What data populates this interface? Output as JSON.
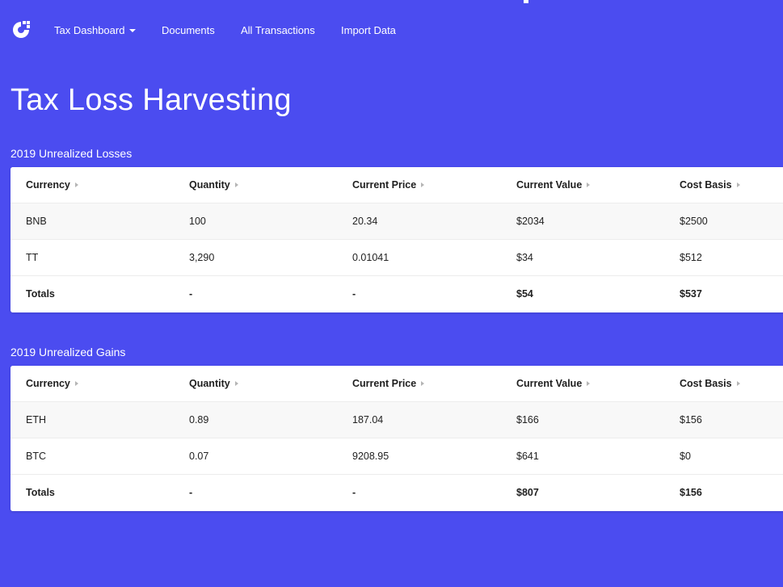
{
  "nav": {
    "items": [
      {
        "label": "Tax Dashboard",
        "has_dropdown": true
      },
      {
        "label": "Documents"
      },
      {
        "label": "All Transactions"
      },
      {
        "label": "Import Data"
      }
    ]
  },
  "page": {
    "title": "Tax Loss Harvesting"
  },
  "losses": {
    "title": "2019 Unrealized Losses",
    "columns": [
      "Currency",
      "Quantity",
      "Current Price",
      "Current Value",
      "Cost Basis"
    ],
    "rows": [
      [
        "BNB",
        "100",
        "20.34",
        "$2034",
        "$2500"
      ],
      [
        "TT",
        "3,290",
        "0.01041",
        "$34",
        "$512"
      ]
    ],
    "totals": [
      "Totals",
      "-",
      "-",
      "$54",
      "$537"
    ]
  },
  "gains": {
    "title": "2019 Unrealized Gains",
    "columns": [
      "Currency",
      "Quantity",
      "Current Price",
      "Current Value",
      "Cost Basis"
    ],
    "rows": [
      [
        "ETH",
        "0.89",
        "187.04",
        "$166",
        "$156"
      ],
      [
        "BTC",
        "0.07",
        "9208.95",
        "$641",
        "$0"
      ]
    ],
    "totals": [
      "Totals",
      "-",
      "-",
      "$807",
      "$156"
    ]
  },
  "colors": {
    "background": "#4b4cf0",
    "card": "#ffffff",
    "row_alt": "#f8f8f8"
  }
}
